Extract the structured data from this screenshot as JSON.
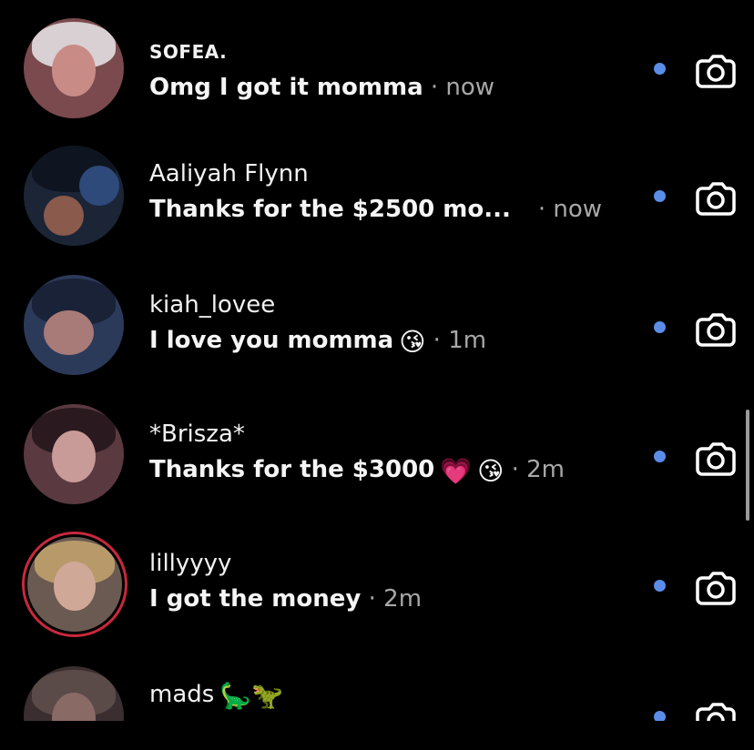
{
  "conversations": [
    {
      "name": "SOFEA.",
      "message": "Omg I got it momma",
      "time": " · now",
      "emojis": [],
      "unread": true,
      "story_ring": false
    },
    {
      "name": "Aaliyah Flynn",
      "message": "Thanks for the $2500 mo...",
      "time": "· now",
      "emojis": [],
      "unread": true,
      "story_ring": false
    },
    {
      "name": "kiah_lovee",
      "message": "I love you momma",
      "time": " · 1m",
      "emojis": [
        "😘"
      ],
      "unread": true,
      "story_ring": false
    },
    {
      "name": "*Brisza*",
      "message": "Thanks for the $3000",
      "time": " · 2m",
      "emojis": [
        "💗",
        "😘"
      ],
      "unread": true,
      "story_ring": false
    },
    {
      "name": "lillyyyy",
      "message": "I got the money",
      "time": " · 2m",
      "emojis": [],
      "unread": true,
      "story_ring": true
    },
    {
      "name": "mads",
      "name_emojis": "🦕🦖",
      "unread": true,
      "story_ring": false
    }
  ],
  "icons": {
    "camera": "camera-icon",
    "unread": "unread-dot-icon"
  },
  "colors": {
    "background": "#000000",
    "unread_dot": "#5b8de8",
    "story_ring": "#c8283c",
    "timestamp": "#a8a8a8"
  }
}
